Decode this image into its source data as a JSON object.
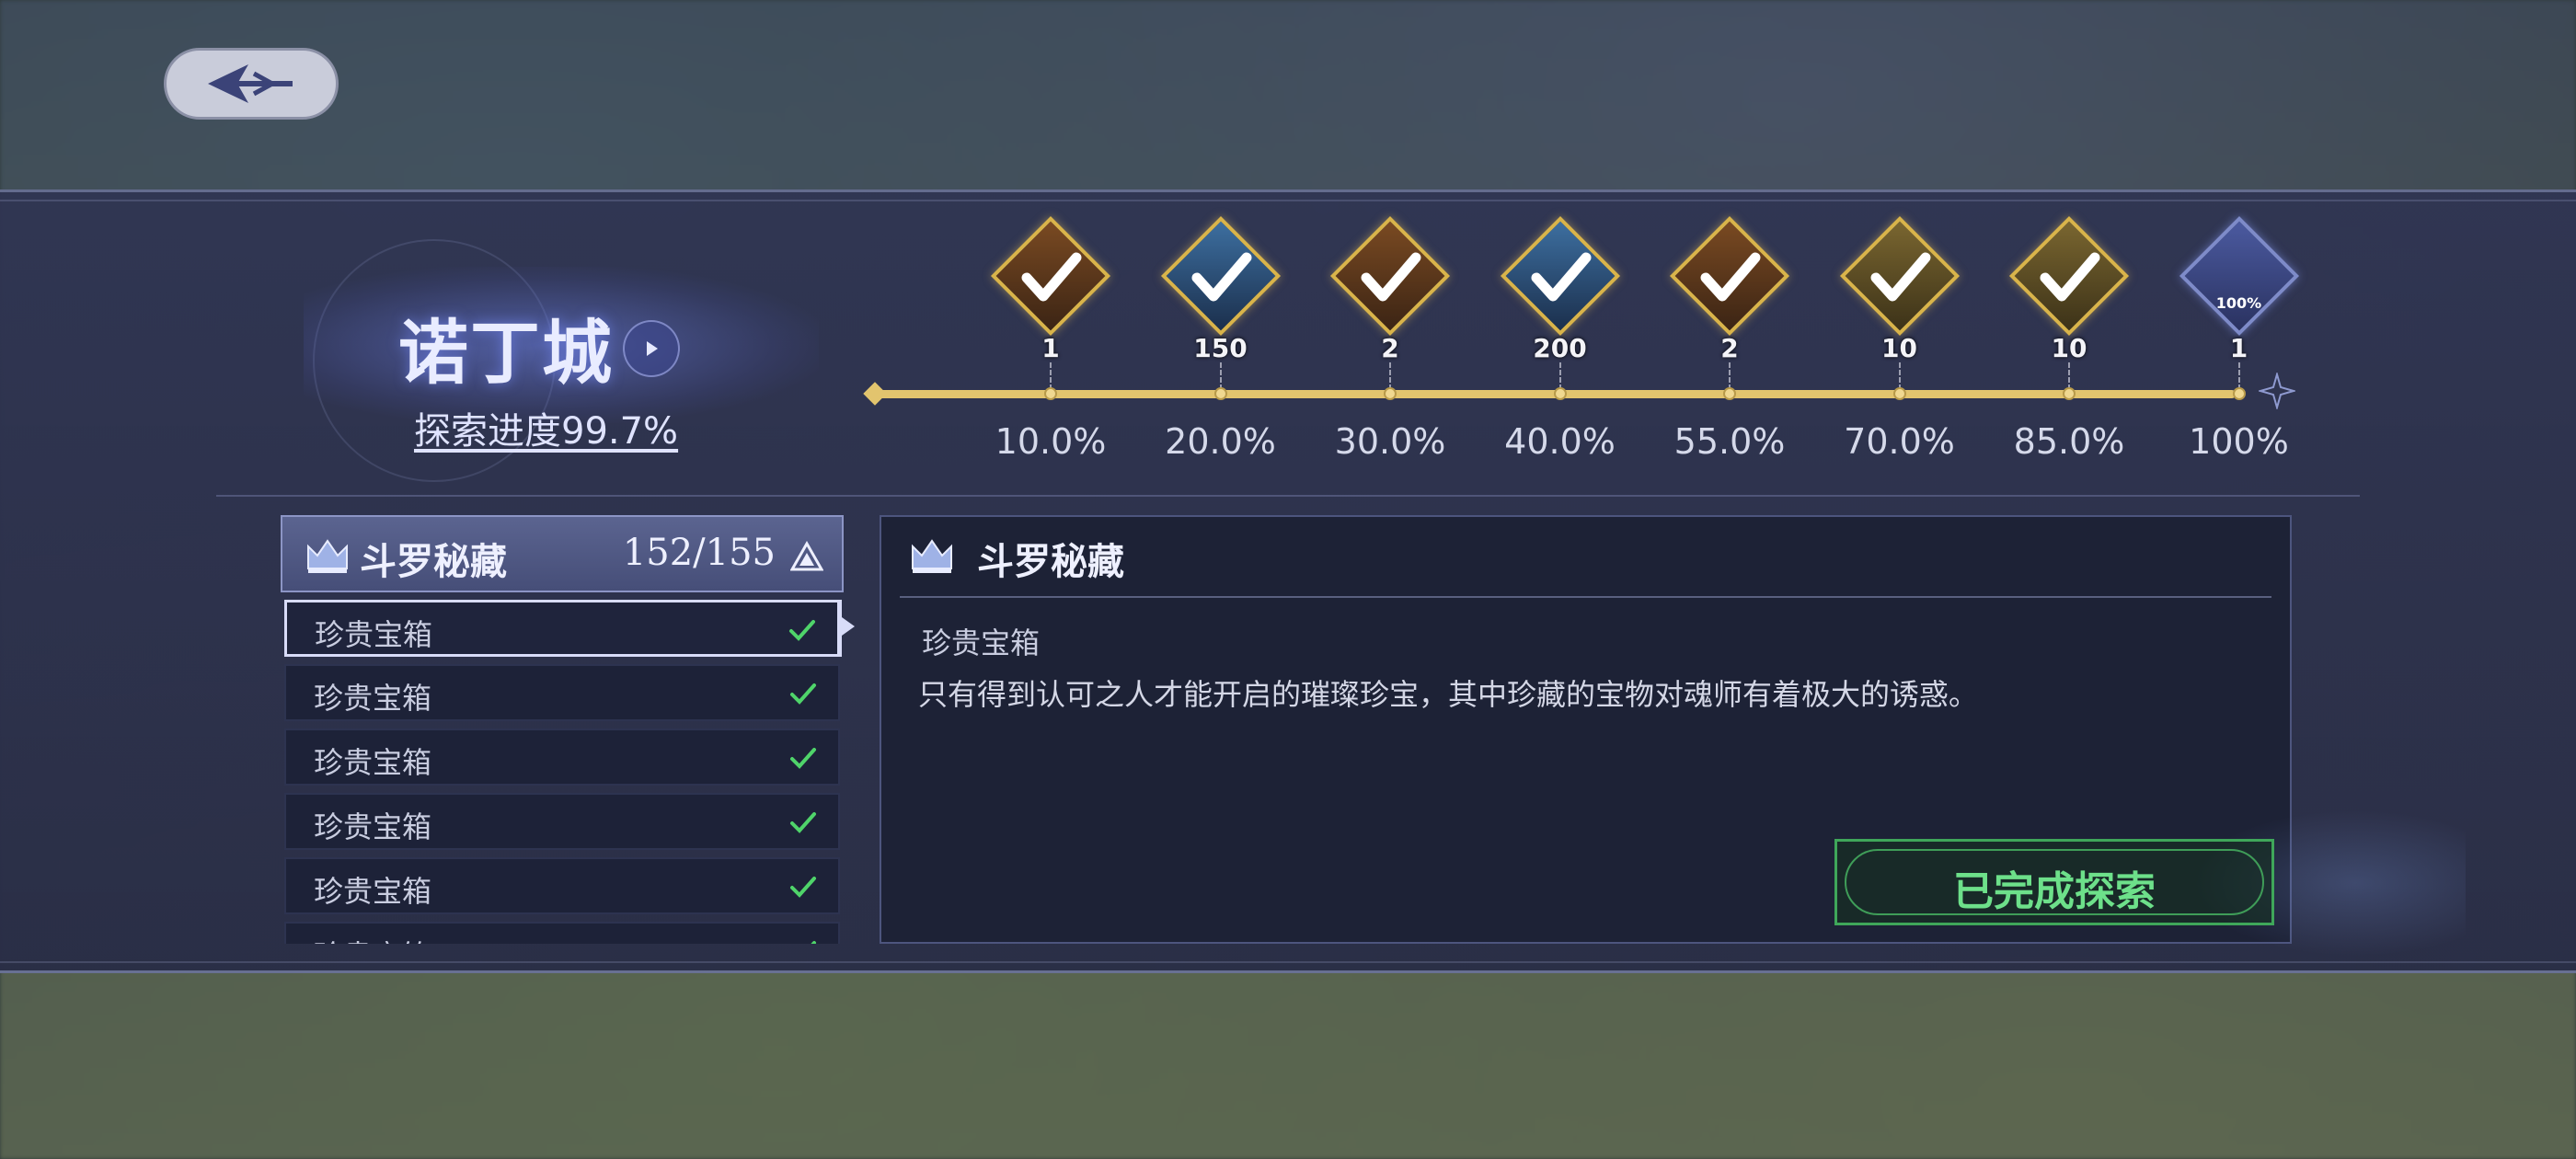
{
  "city": {
    "name": "诺丁城",
    "progress_label": "探索进度99.7%"
  },
  "milestones": [
    {
      "count": "1",
      "percent": "10.0%",
      "style": "red",
      "completed": true
    },
    {
      "count": "150",
      "percent": "20.0%",
      "style": "blue",
      "completed": true
    },
    {
      "count": "2",
      "percent": "30.0%",
      "style": "red",
      "completed": true
    },
    {
      "count": "200",
      "percent": "40.0%",
      "style": "blue",
      "completed": true
    },
    {
      "count": "2",
      "percent": "55.0%",
      "style": "red",
      "completed": true
    },
    {
      "count": "10",
      "percent": "70.0%",
      "style": "gold",
      "completed": true
    },
    {
      "count": "10",
      "percent": "85.0%",
      "style": "gold",
      "completed": true
    },
    {
      "count": "1",
      "percent": "100%",
      "style": "final",
      "completed": false,
      "badge_text": "100%"
    }
  ],
  "category": {
    "title": "斗罗秘藏",
    "count": "152/155"
  },
  "items": [
    {
      "label": "珍贵宝箱",
      "done": true,
      "selected": true
    },
    {
      "label": "珍贵宝箱",
      "done": true,
      "selected": false
    },
    {
      "label": "珍贵宝箱",
      "done": true,
      "selected": false
    },
    {
      "label": "珍贵宝箱",
      "done": true,
      "selected": false
    },
    {
      "label": "珍贵宝箱",
      "done": true,
      "selected": false
    },
    {
      "label": "珍贵宝箱",
      "done": true,
      "selected": false
    }
  ],
  "detail": {
    "title": "斗罗秘藏",
    "item_name": "珍贵宝箱",
    "description": "只有得到认可之人才能开启的璀璨珍宝，其中珍藏的宝物对魂师有着极大的诱惑。",
    "button_label": "已完成探索"
  },
  "colors": {
    "track": "#e2c46e",
    "check": "#4fd46a",
    "done_button": "#6de08a"
  }
}
